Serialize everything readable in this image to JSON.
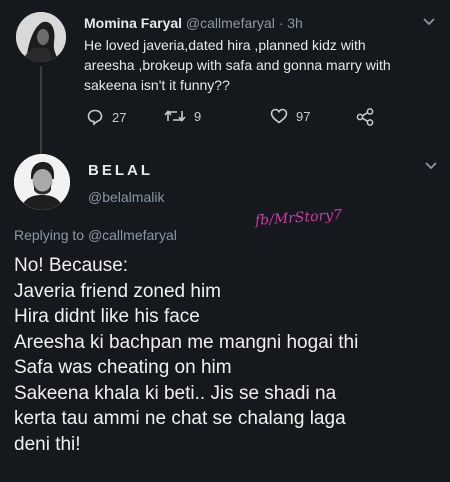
{
  "original_tweet": {
    "author_name": "Momina Faryal",
    "handle_time": "@callmefaryal · 3h",
    "text": "He loved javeria,dated hira ,planned kidz with areesha ,brokeup with safa and gonna marry with sakeena isn't it funny??",
    "actions": {
      "reply_count": "27",
      "retweet_count": "9",
      "like_count": "97"
    }
  },
  "reply": {
    "author_name": "BELAL",
    "handle": "@belalmalik",
    "replying_prefix": "Replying to",
    "replying_to": "@callmefaryal",
    "watermark": "fb/MrStory7",
    "lines": [
      "No! Because:",
      "Javeria friend zoned him",
      "Hira didnt like his face",
      "Areesha ki bachpan me mangni hogai thi",
      "Safa was cheating on him",
      "Sakeena khala ki beti.. Jis se shadi na",
      "kerta tau ammi ne chat se chalang laga",
      "deni thi!"
    ]
  },
  "icons": {
    "reply": "reply-icon",
    "retweet": "retweet-icon",
    "like": "heart-icon",
    "share": "share-icon",
    "menu": "chevron-down-icon"
  },
  "colors": {
    "background": "#15181c",
    "text": "#e7e9ea",
    "muted": "#8b98a5",
    "watermark": "#d23aa6"
  }
}
